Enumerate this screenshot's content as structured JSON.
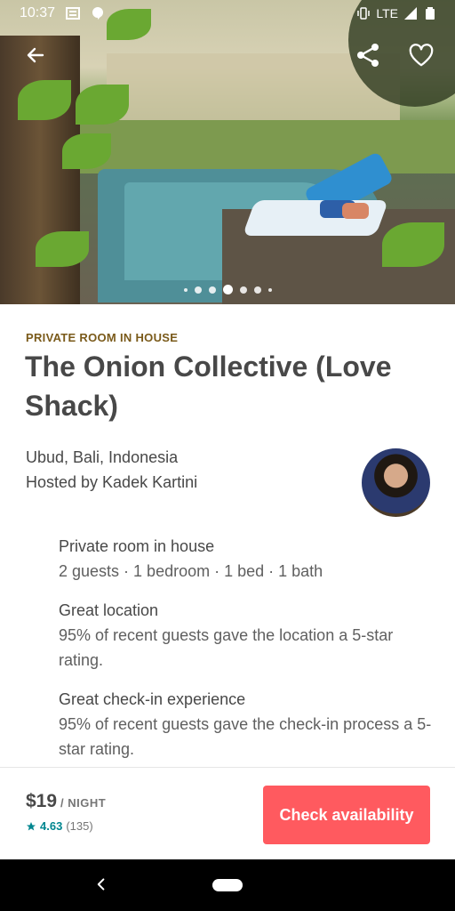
{
  "status_bar": {
    "time": "10:37",
    "network": "LTE"
  },
  "listing": {
    "room_type_label": "PRIVATE ROOM IN HOUSE",
    "title": "The Onion Collective (Love Shack)",
    "location": "Ubud, Bali, Indonesia",
    "host": "Hosted by Kadek Kartini",
    "photo_count": 6,
    "active_photo_index": 3
  },
  "highlights": [
    {
      "title": "Private room in house",
      "desc": "2 guests · 1 bedroom · 1 bed · 1 bath"
    },
    {
      "title": "Great location",
      "desc": "95% of recent guests gave the location a 5-star rating."
    },
    {
      "title": "Great check-in experience",
      "desc": "95% of recent guests gave the check-in process a 5-star rating."
    }
  ],
  "booking": {
    "price": "$19",
    "unit": "/ NIGHT",
    "rating": "4.63",
    "reviews": "(135)",
    "cta": "Check availability"
  },
  "colors": {
    "accent": "#ff5a5f",
    "rating": "#00868f",
    "room_type": "#7a5a1a"
  }
}
